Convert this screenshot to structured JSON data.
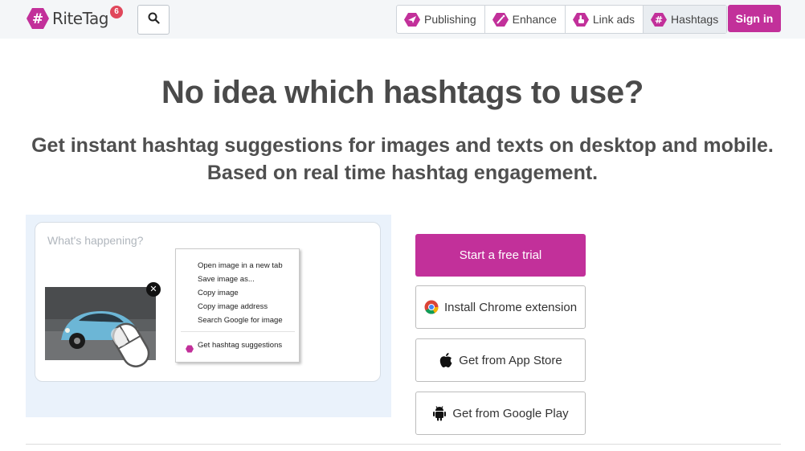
{
  "header": {
    "logo_text": "RiteTag",
    "notification_count": "6",
    "nav": [
      {
        "label": "Publishing",
        "icon": "paper-plane-icon"
      },
      {
        "label": "Enhance",
        "icon": "magic-wand-icon"
      },
      {
        "label": "Link ads",
        "icon": "pointer-hand-icon"
      },
      {
        "label": "Hashtags",
        "icon": "hashtag-icon"
      }
    ],
    "signin_label": "Sign in"
  },
  "hero": {
    "headline": "No idea which hashtags to use?",
    "sub_line1": "Get instant hashtag suggestions for images and texts on desktop and mobile.",
    "sub_line2": "Based on real time hashtag engagement."
  },
  "demo": {
    "composer_placeholder": "What's happening?",
    "context_menu": [
      "Open image in a new tab",
      "Save image as...",
      "Copy image",
      "Copy image address",
      "Search Google for image"
    ],
    "context_menu_special": "Get hashtag suggestions"
  },
  "cta": {
    "primary": "Start a free trial",
    "chrome": "Install Chrome extension",
    "appstore": "Get from App Store",
    "googleplay": "Get from Google Play"
  },
  "colors": {
    "brand": "#c2309a",
    "badge": "#e0475b"
  }
}
